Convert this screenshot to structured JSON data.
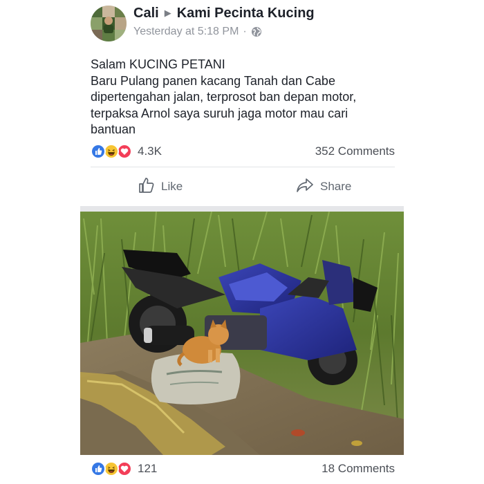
{
  "post": {
    "author": "Cali",
    "group": "Kami Pecinta Kucing",
    "time": "Yesterday at 5:18 PM",
    "privacy_icon": "globe-icon",
    "text_lines": [
      "Salam KUCING PETANI",
      "Baru Pulang panen kacang Tanah dan Cabe",
      "dipertengahan jalan, terprosot ban depan motor,",
      "terpaksa Arnol saya suruh jaga motor mau cari",
      "bantuan"
    ],
    "reaction_icons": [
      "like-reaction-icon",
      "haha-reaction-icon",
      "love-reaction-icon"
    ],
    "reaction_count": "4.3K",
    "comment_count": "352 Comments"
  },
  "actions": {
    "like_label": "Like",
    "share_label": "Share"
  },
  "photo_post": {
    "reaction_icons": [
      "like-reaction-icon",
      "haha-reaction-icon",
      "love-reaction-icon"
    ],
    "reaction_count": "121",
    "comment_count": "18 Comments"
  },
  "colors": {
    "like_blue": "#3578e5",
    "haha_yellow": "#f7c533",
    "love_red": "#f33e58",
    "text_primary": "#1d2129",
    "text_secondary": "#90949c"
  }
}
